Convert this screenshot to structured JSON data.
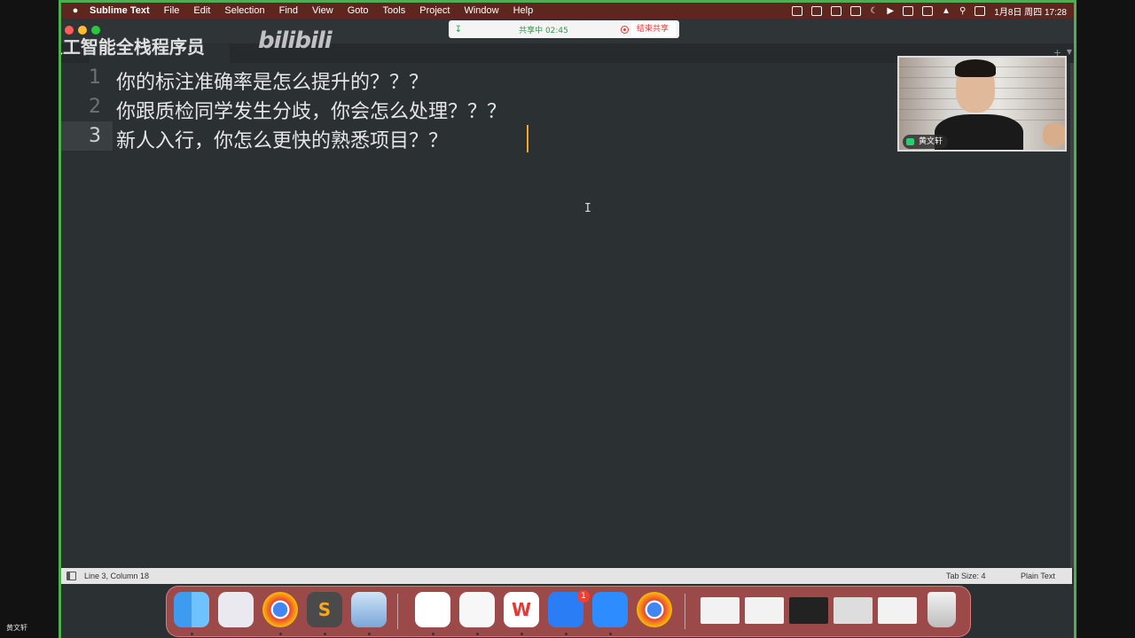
{
  "menubar": {
    "app": "Sublime Text",
    "items": [
      "File",
      "Edit",
      "Selection",
      "Find",
      "View",
      "Goto",
      "Tools",
      "Project",
      "Window",
      "Help"
    ],
    "clock": "1月8日 周四 17:28"
  },
  "share": {
    "status": "共享中 02:45",
    "end_label": "结束共享"
  },
  "watermark": {
    "channel": "AI人工智能全栈程序员",
    "logo": "bilibili"
  },
  "editor": {
    "lines": [
      {
        "num": "1",
        "text": "你的标注准确率是怎么提升的？？？"
      },
      {
        "num": "2",
        "text": "你跟质检同学发生分歧，你会怎么处理？？？"
      },
      {
        "num": "3",
        "text": "新人入行，你怎么更快的熟悉项目？？"
      }
    ],
    "current_line": 3
  },
  "video": {
    "participant": "黄文轩"
  },
  "statusbar": {
    "position": "Line 3, Column 18",
    "tab_size": "Tab Size: 4",
    "syntax": "Plain Text"
  },
  "dock": {
    "badge": "1"
  },
  "viewer": {
    "name": "黄文轩"
  }
}
